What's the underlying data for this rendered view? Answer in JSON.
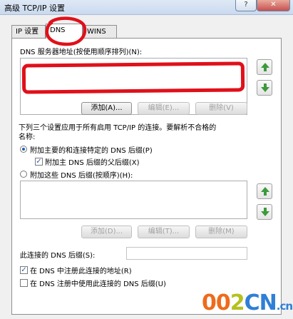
{
  "window": {
    "title": "高级 TCP/IP 设置",
    "help_btn": "?",
    "close_btn": "✕"
  },
  "tabs": [
    {
      "label": "IP 设置"
    },
    {
      "label": "DNS"
    },
    {
      "label": "WINS"
    }
  ],
  "dns": {
    "servers_label": "DNS 服务器地址(按使用顺序排列)(N):",
    "server_buttons": {
      "add": "添加(A)...",
      "edit": "编辑(E)...",
      "remove": "删除(V)"
    },
    "info_text_1": "下列三个设置应用于所有启用 TCP/IP 的连接。要解析不合格的",
    "info_text_2": "名称:",
    "radio_primary": "附加主要的和连接特定的 DNS 后缀(P)",
    "check_parent": "附加主 DNS 后缀的父后缀(X)",
    "radio_these": "附加这些 DNS 后缀(按顺序)(H):",
    "suffix_buttons": {
      "add": "添加(D)...",
      "edit": "编辑(T)...",
      "remove": "删除(M)"
    },
    "conn_suffix_label": "此连接的 DNS 后缀(S):",
    "conn_suffix_value": "",
    "check_register": "在 DNS 中注册此连接的地址(R)",
    "check_use_suffix": "在 DNS 注册中使用此连接的 DNS 后缀(U)",
    "state": {
      "radio_primary": true,
      "check_parent": true,
      "radio_these": false,
      "check_register": true,
      "check_use_suffix": false
    }
  },
  "watermark": {
    "part1": "00",
    "part2": "2",
    "part3": "CN",
    "suffix": ".cn"
  },
  "colors": {
    "annotation_red": "#e0101a",
    "accent_blue": "#1e5fb3"
  }
}
